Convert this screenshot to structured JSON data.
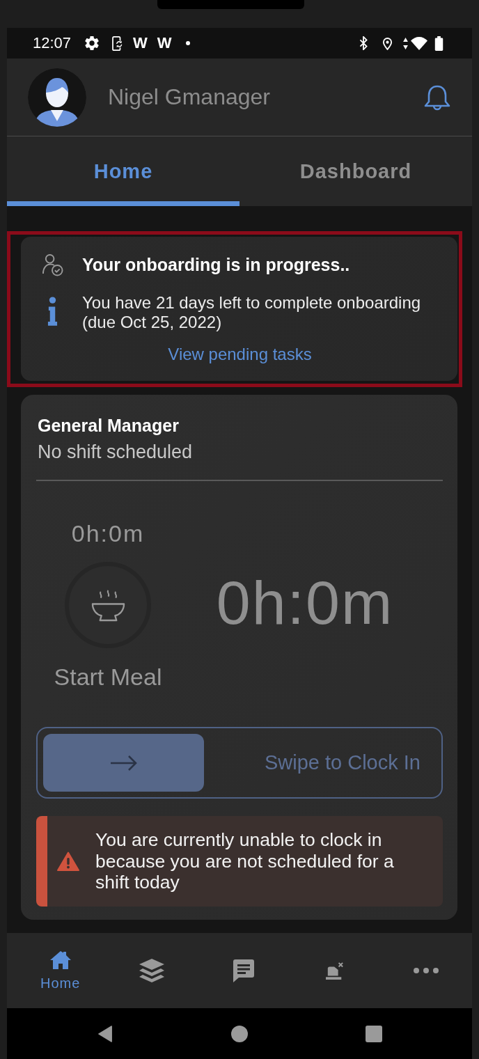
{
  "status_bar": {
    "time": "12:07",
    "notification_letters": [
      "W",
      "W"
    ]
  },
  "header": {
    "user_name": "Nigel Gmanager"
  },
  "tabs": [
    {
      "label": "Home",
      "selected": true
    },
    {
      "label": "Dashboard",
      "selected": false
    }
  ],
  "onboarding_card": {
    "highlighted": true,
    "title": "Your onboarding is in progress..",
    "message": "You have 21 days left to complete onboarding (due Oct 25, 2022)",
    "link": "View pending tasks"
  },
  "shift_card": {
    "role": "General Manager",
    "shift_status": "No shift scheduled",
    "meal_timer": "0h:0m",
    "meal_label": "Start Meal",
    "shift_timer": "0h:0m",
    "swipe_label": "Swipe to Clock In",
    "alert": "You are currently unable to clock in because you are not scheduled for a shift today"
  },
  "bottom_nav": [
    {
      "kind": "home",
      "label": "Home",
      "selected": true
    },
    {
      "kind": "layers",
      "selected": false
    },
    {
      "kind": "chat",
      "selected": false
    },
    {
      "kind": "time-clock",
      "selected": false
    },
    {
      "kind": "more",
      "selected": false
    }
  ]
}
